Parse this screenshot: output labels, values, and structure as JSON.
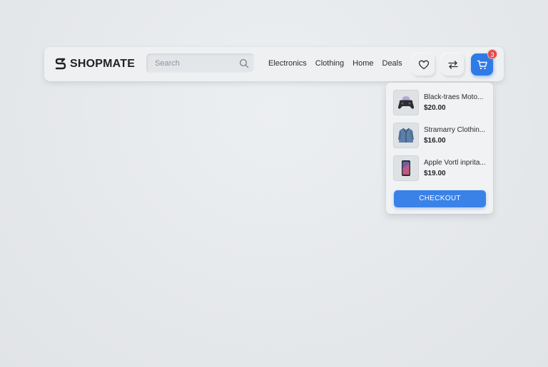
{
  "brand": {
    "name": "SHOPMATE"
  },
  "search": {
    "placeholder": "Search"
  },
  "nav": {
    "links": [
      "Electronics",
      "Clothing",
      "Home",
      "Deals"
    ]
  },
  "actions": {
    "wishlist_icon": "heart-icon",
    "compare_icon": "swap-arrows-icon",
    "cart_icon": "cart-icon",
    "cart_count": "3"
  },
  "cart": {
    "items": [
      {
        "name": "Black-traes Moto...",
        "price": "$20.00",
        "thumb": "gamepad"
      },
      {
        "name": "Stramarry Clothin...",
        "price": "$16.00",
        "thumb": "jacket"
      },
      {
        "name": "Apple Vortl inprita...",
        "price": "$19.00",
        "thumb": "phone"
      }
    ],
    "checkout_label": "CHECKOUT"
  },
  "colors": {
    "accent": "#2f7be6",
    "badge": "#e24b4b",
    "background": "#e6e9ec"
  }
}
